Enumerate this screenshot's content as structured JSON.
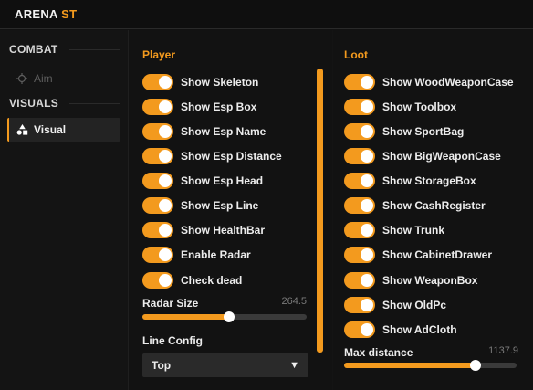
{
  "window": {
    "title_main": "ARENA",
    "title_accent": "ST"
  },
  "colors": {
    "accent": "#f39a1e",
    "background": "#121212",
    "sidebar_active": "#232323",
    "track": "#3a3a3a"
  },
  "sidebar": {
    "sections": [
      {
        "label": "COMBAT",
        "items": [
          {
            "label": "Aim",
            "icon": "crosshair-icon",
            "active": false
          }
        ]
      },
      {
        "label": "VISUALS",
        "items": [
          {
            "label": "Visual",
            "icon": "shapes-icon",
            "active": true
          }
        ]
      }
    ]
  },
  "player": {
    "title": "Player",
    "toggles": [
      {
        "label": "Show Skeleton",
        "on": true
      },
      {
        "label": "Show Esp Box",
        "on": true
      },
      {
        "label": "Show Esp Name",
        "on": true
      },
      {
        "label": "Show Esp Distance",
        "on": true
      },
      {
        "label": "Show Esp Head",
        "on": true
      },
      {
        "label": "Show Esp Line",
        "on": true
      },
      {
        "label": "Show HealthBar",
        "on": true
      },
      {
        "label": "Enable Radar",
        "on": true
      },
      {
        "label": "Check dead",
        "on": true
      }
    ],
    "radar_size": {
      "label": "Radar Size",
      "value": "264.5",
      "fill_fraction": 0.53
    },
    "line_config": {
      "label": "Line Config",
      "selected": "Top"
    }
  },
  "loot": {
    "title": "Loot",
    "toggles": [
      {
        "label": "Show WoodWeaponCase",
        "on": true
      },
      {
        "label": "Show Toolbox",
        "on": true
      },
      {
        "label": "Show SportBag",
        "on": true
      },
      {
        "label": "Show BigWeaponCase",
        "on": true
      },
      {
        "label": "Show StorageBox",
        "on": true
      },
      {
        "label": "Show CashRegister",
        "on": true
      },
      {
        "label": "Show Trunk",
        "on": true
      },
      {
        "label": "Show CabinetDrawer",
        "on": true
      },
      {
        "label": "Show WeaponBox",
        "on": true
      },
      {
        "label": "Show OldPc",
        "on": true
      },
      {
        "label": "Show AdCloth",
        "on": true
      }
    ],
    "max_distance": {
      "label": "Max distance",
      "value": "1137.9",
      "fill_fraction": 0.76
    }
  }
}
